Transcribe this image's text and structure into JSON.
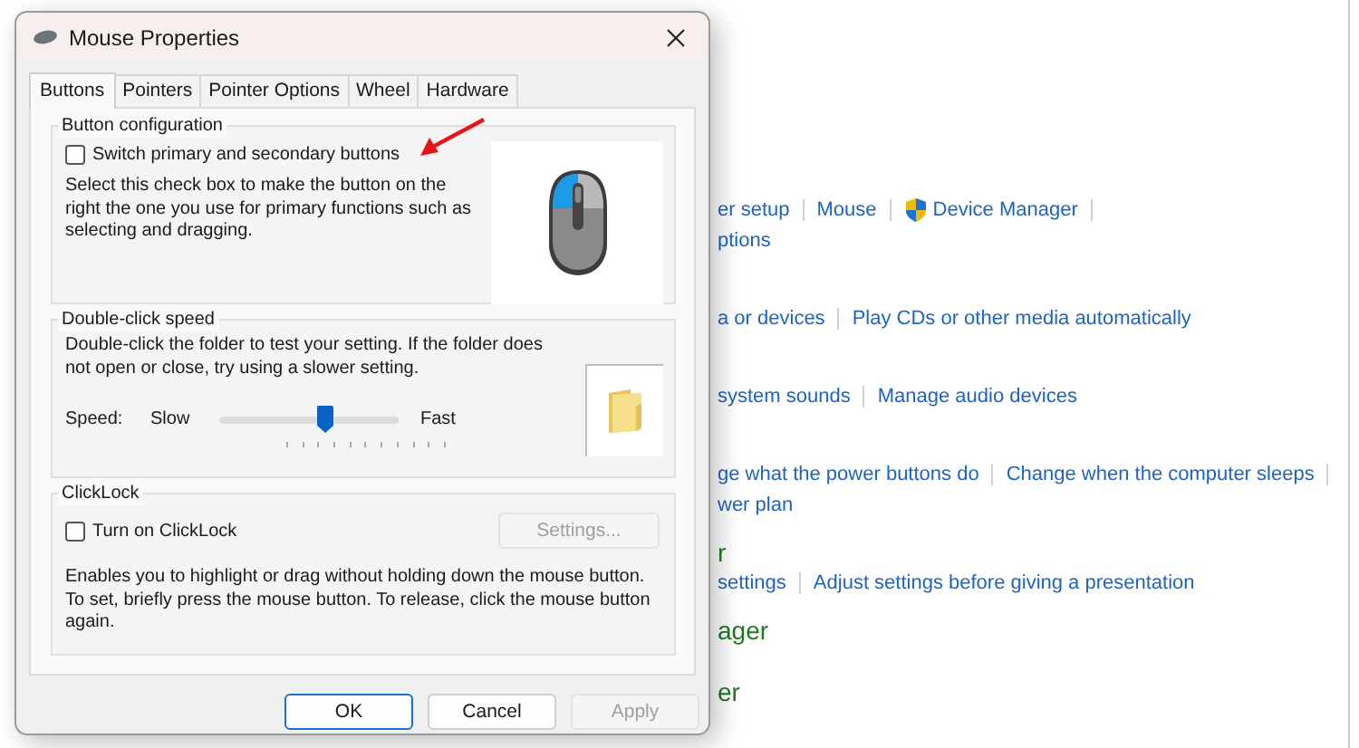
{
  "background": {
    "rows": [
      {
        "items": [
          {
            "kind": "link",
            "text": "er setup"
          },
          {
            "kind": "link",
            "text": "Mouse"
          },
          {
            "kind": "link",
            "text": "Device Manager",
            "shield": true
          }
        ],
        "trailing_separator": true
      },
      {
        "items": [
          {
            "kind": "link",
            "text": "ptions"
          }
        ]
      },
      {
        "items": [
          {
            "kind": "link",
            "text": "a or devices"
          },
          {
            "kind": "link",
            "text": "Play CDs or other media automatically"
          }
        ]
      },
      {
        "items": [
          {
            "kind": "link",
            "text": "system sounds"
          },
          {
            "kind": "link",
            "text": "Manage audio devices"
          }
        ]
      },
      {
        "items": [
          {
            "kind": "link",
            "text": "ge what the power buttons do"
          },
          {
            "kind": "link",
            "text": "Change when the computer sleeps"
          }
        ],
        "trailing_separator": true
      },
      {
        "items": [
          {
            "kind": "link",
            "text": "wer plan"
          }
        ]
      },
      {
        "items": [
          {
            "kind": "heading",
            "text": "r"
          }
        ]
      },
      {
        "items": [
          {
            "kind": "link",
            "text": "settings"
          },
          {
            "kind": "link",
            "text": "Adjust settings before giving a presentation"
          }
        ]
      },
      {
        "items": [
          {
            "kind": "heading",
            "text": "ager"
          }
        ]
      },
      {
        "items": [
          {
            "kind": "heading",
            "text": "er"
          }
        ]
      }
    ]
  },
  "window": {
    "title": "Mouse Properties"
  },
  "tabs": [
    {
      "label": "Buttons",
      "selected": true
    },
    {
      "label": "Pointers",
      "selected": false
    },
    {
      "label": "Pointer Options",
      "selected": false
    },
    {
      "label": "Wheel",
      "selected": false
    },
    {
      "label": "Hardware",
      "selected": false
    }
  ],
  "button_configuration": {
    "title": "Button configuration",
    "checkbox": {
      "label": "Switch primary and secondary buttons",
      "checked": false
    },
    "description": "Select this check box to make the button on the right the one you use for primary functions such as selecting and dragging."
  },
  "double_click_speed": {
    "title": "Double-click speed",
    "description": "Double-click the folder to test your setting. If the folder does not open or close, try using a slower setting.",
    "speed_label": "Speed:",
    "slow_label": "Slow",
    "fast_label": "Fast",
    "slider": {
      "level": 0.59
    }
  },
  "clicklock": {
    "title": "ClickLock",
    "checkbox": {
      "label": "Turn on ClickLock",
      "checked": false
    },
    "settings_button": {
      "label": "Settings...",
      "disabled": true
    },
    "description": "Enables you to highlight or drag without holding down the mouse button. To set, briefly press the mouse button. To release, click the mouse button again."
  },
  "buttons": [
    {
      "label": "OK",
      "default": true,
      "disabled": false
    },
    {
      "label": "Cancel",
      "default": false,
      "disabled": false
    },
    {
      "label": "Apply",
      "default": false,
      "disabled": true
    }
  ]
}
